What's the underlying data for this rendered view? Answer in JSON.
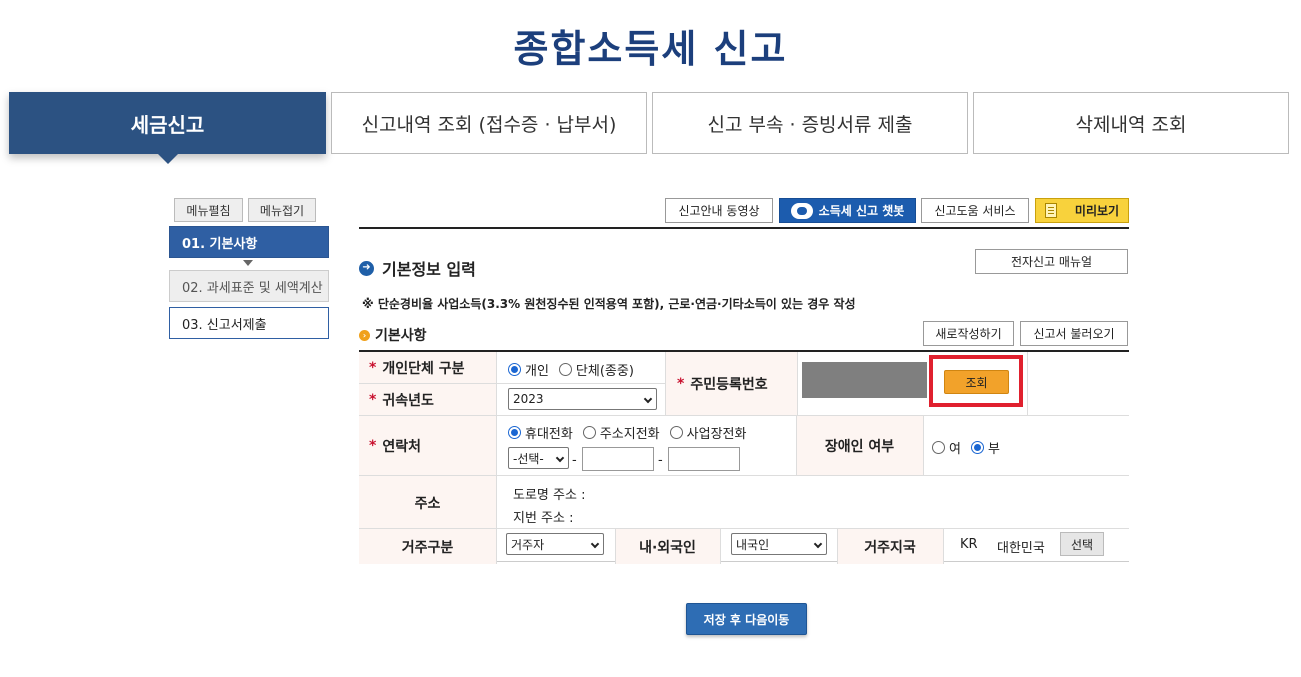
{
  "page": {
    "title": "종합소득세  신고"
  },
  "tabs": [
    {
      "label": "세금신고",
      "active": true
    },
    {
      "label": "신고내역 조회 (접수증 · 납부서)"
    },
    {
      "label": "신고 부속 · 증빙서류 제출"
    },
    {
      "label": "삭제내역 조회"
    }
  ],
  "sidebar": {
    "expand_label": "메뉴펼침",
    "collapse_label": "메뉴접기",
    "steps": [
      {
        "label": "01. 기본사항",
        "active": true
      },
      {
        "label": "02. 과세표준 및 세액계산"
      },
      {
        "label": "03. 신고서제출"
      }
    ]
  },
  "toolbar": {
    "video_label": "신고안내 동영상",
    "chatbot_label": "소득세 신고 챗봇",
    "help_label": "신고도움 서비스",
    "preview_label": "미리보기"
  },
  "section": {
    "title": "기본정보 입력",
    "manual_label": "전자신고 매뉴얼",
    "note": "※ 단순경비율 사업소득(3.3% 원천징수된 인적용역 포함), 근로·연금·기타소득이 있는 경우 작성",
    "sub_title": "기본사항",
    "new_label": "새로작성하기",
    "load_label": "신고서 불러오기"
  },
  "form": {
    "req_mark": "*",
    "type": {
      "label": "개인단체 구분",
      "options": [
        "개인",
        "단체(종중)"
      ],
      "selected": "개인"
    },
    "year": {
      "label": "귀속년도",
      "value": "2023"
    },
    "rrn": {
      "label": "주민등록번호",
      "lookup_label": "조회"
    },
    "contact": {
      "label": "연락처",
      "options": [
        "휴대전화",
        "주소지전화",
        "사업장전화"
      ],
      "selected": "휴대전화",
      "prefix_value": "-선택-",
      "dash": "-"
    },
    "disability": {
      "label": "장애인 여부",
      "options": [
        "여",
        "부"
      ],
      "selected": "부"
    },
    "address": {
      "label": "주소",
      "road_label": "도로명 주소 :",
      "lot_label": "지번 주소 :"
    },
    "residence": {
      "label": "거주구분",
      "value": "거주자"
    },
    "nationality": {
      "label": "내·외국인",
      "value": "내국인"
    },
    "country": {
      "label": "거주지국",
      "code": "KR",
      "name": "대한민국",
      "select_label": "선택"
    }
  },
  "actions": {
    "save_label": "저장 후 다음이동"
  },
  "colors": {
    "brand": "#2c5282",
    "title": "#1c3f7c",
    "highlight": "#e0202e",
    "lookup": "#f2a22a"
  }
}
